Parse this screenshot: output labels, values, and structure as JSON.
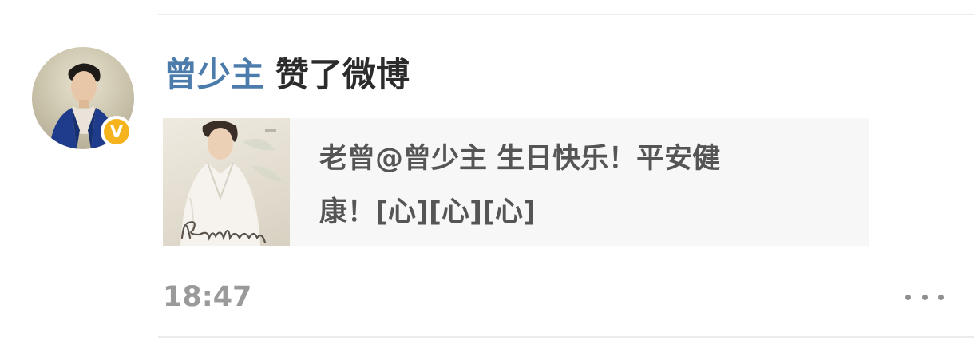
{
  "feed_item": {
    "user": {
      "name": "曾少主",
      "avatar_icon": "user-avatar",
      "verified_badge": "V",
      "verified_color": "#f5b41e"
    },
    "action_text": "赞了微博",
    "card": {
      "text_line1": "老曾@曾少主 生日快乐！平安健",
      "text_line2": "康！[心][心][心]",
      "thumbnail_icon": "birthday-poster-thumbnail"
    },
    "timestamp": "18:47",
    "more_icon": "more-dots-icon"
  },
  "colors": {
    "username": "#4c7cab",
    "action_text": "#2b2b2b",
    "card_text": "#555555",
    "card_bg": "#f7f7f7",
    "timestamp": "#9a9a9a"
  }
}
